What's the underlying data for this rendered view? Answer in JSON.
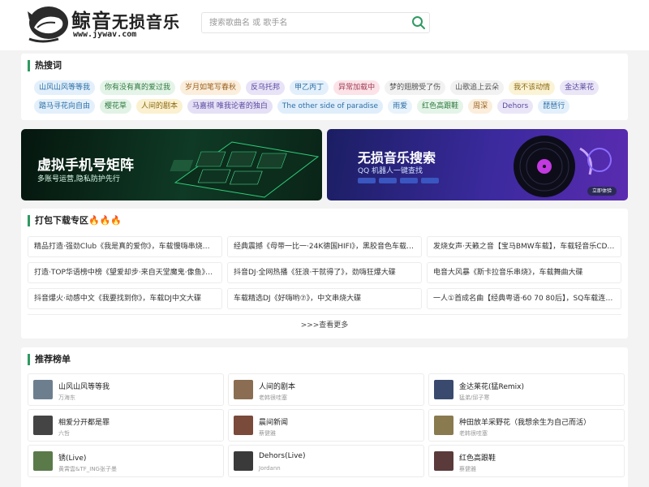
{
  "site": {
    "logo_cn_big": "鲸音",
    "logo_cn_small": "无损音乐",
    "logo_url": "www.jywav.com"
  },
  "search": {
    "placeholder": "搜索歌曲名 或 歌手名"
  },
  "hot": {
    "title": "热搜词",
    "row1": [
      {
        "label": "山风山风等等我",
        "bg": "#e3f0fb",
        "fg": "#2c6ea5"
      },
      {
        "label": "你有没有真的爱过我",
        "bg": "#e5f4e8",
        "fg": "#2e7a3f"
      },
      {
        "label": "岁月如笔写春秋",
        "bg": "#fbeedc",
        "fg": "#9a6220"
      },
      {
        "label": "反乌托邦",
        "bg": "#e8e3f7",
        "fg": "#5b4aa0"
      },
      {
        "label": "甲乙丙丁",
        "bg": "#e3f0fb",
        "fg": "#2c6ea5"
      },
      {
        "label": "异常加载中",
        "bg": "#fbe3e8",
        "fg": "#a03a52"
      },
      {
        "label": "梦的翅膀受了伤",
        "bg": "#f2f2f2",
        "fg": "#555555"
      },
      {
        "label": "山歌追上云朵",
        "bg": "#f2f2f2",
        "fg": "#555555"
      },
      {
        "label": "我不该动情",
        "bg": "#fbf3d6",
        "fg": "#8a6a10"
      },
      {
        "label": "金达莱花",
        "bg": "#ebe6f7",
        "fg": "#5b4aa0"
      }
    ],
    "row2": [
      {
        "label": "踏马寻花向自由",
        "bg": "#e3f0fb",
        "fg": "#2c6ea5"
      },
      {
        "label": "樱花草",
        "bg": "#e2f3e6",
        "fg": "#2e7a3f"
      },
      {
        "label": "人间的剧本",
        "bg": "#fbf0cf",
        "fg": "#8a6a10"
      },
      {
        "label": "马嘉祺 唯我论者的独白",
        "bg": "#e5e0f5",
        "fg": "#5b4aa0"
      },
      {
        "label": "The other side of paradise",
        "bg": "#e0eefb",
        "fg": "#2c6ea5"
      },
      {
        "label": "雨爱",
        "bg": "#e8f3fb",
        "fg": "#2c6ea5"
      },
      {
        "label": "红色高跟鞋",
        "bg": "#e5f4e8",
        "fg": "#2e7a3f"
      },
      {
        "label": "周深",
        "bg": "#fbeedc",
        "fg": "#9a6220"
      },
      {
        "label": "Dehors",
        "bg": "#ebe6f7",
        "fg": "#5b4aa0"
      },
      {
        "label": "琵琶行",
        "bg": "#e3f0fb",
        "fg": "#2c6ea5"
      }
    ]
  },
  "banners": {
    "left": {
      "title": "虚拟手机号矩阵",
      "sub": "多账号运营,隐私防护先行"
    },
    "right": {
      "title": "无损音乐搜索",
      "sub": "QQ 机器人一键查找",
      "cta": "立即体验"
    }
  },
  "pack": {
    "title": "打包下载专区🔥🔥🔥",
    "items": [
      "精品打造·强劲Club《我是真的爱你》，车载慢嗨串烧舞曲",
      "经典震撼《母带一比一·24K德国HIFI》，黑胶音色车载大碟",
      "发烧女声·天籁之音【宝马BMW车载】，车载轻音乐CD大碟",
      "打造·TOP华语榜中榜《望爱却步·来自天堂魔鬼·像鱼》，车载流行大碟",
      "抖音DJ·全网热播《狂浪·干就得了》，劲嗨狂爆大碟",
      "电音大风暴《斯卡拉音乐串烧》，车载舞曲大碟",
      "抖音爆火·动感中文《我要找到你》，车载DJ中文大碟",
      "车载精选DJ《好嗨哟⑦》，中文串烧大碟",
      "一人①首成名曲【经典粤语·60 70 80后】，SQ车载连版大碟"
    ],
    "more": ">>>查看更多"
  },
  "rec": {
    "title": "推荐榜单",
    "items": [
      {
        "name": "山风山风等等我",
        "artist": "万海东",
        "thumb": "#6d7f8f"
      },
      {
        "name": "人间的剧本",
        "artist": "老韩很哇塞",
        "thumb": "#8a6d52"
      },
      {
        "name": "金达莱花(猛Remix)",
        "artist": "猛弟/邱子寒",
        "thumb": "#3a4a6e"
      },
      {
        "name": "相爱分开都是罪",
        "artist": "六哲",
        "thumb": "#444444"
      },
      {
        "name": "晨间新闻",
        "artist": "蔡健雅",
        "thumb": "#7a4a3a"
      },
      {
        "name": "种田放羊采野花（我想余生为自己而活）",
        "artist": "老韩很哇塞",
        "thumb": "#8a7a50"
      },
      {
        "name": "锈(Live)",
        "artist": "黄霄雲&TF_ING张子墨",
        "thumb": "#5a7a4a"
      },
      {
        "name": "Dehors(Live)",
        "artist": "Jordann",
        "thumb": "#3a3a3a"
      },
      {
        "name": "红色高跟鞋",
        "artist": "蔡健雅",
        "thumb": "#5a3a3a"
      }
    ]
  }
}
